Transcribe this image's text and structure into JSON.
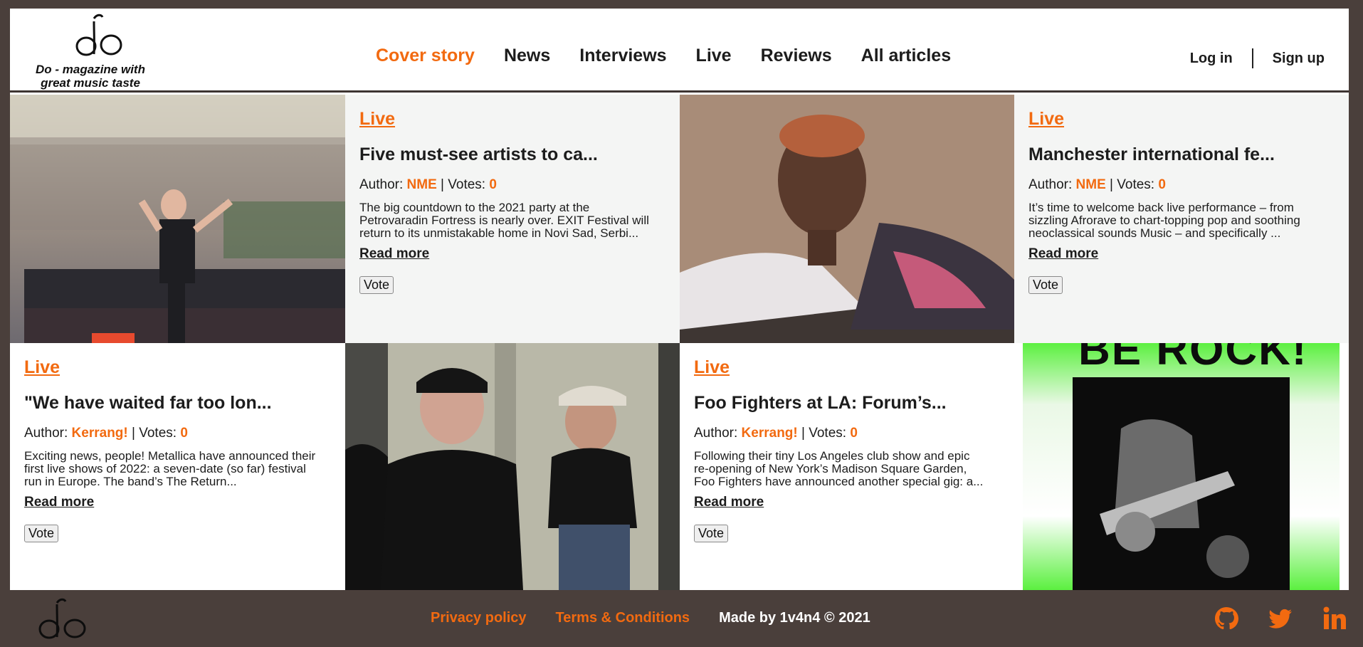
{
  "brand": {
    "tagline": "Do - magazine with great music taste"
  },
  "nav": {
    "items": [
      "Cover story",
      "News",
      "Interviews",
      "Live",
      "Reviews",
      "All articles"
    ],
    "active": "Cover story"
  },
  "auth": {
    "login": "Log in",
    "signup": "Sign up"
  },
  "articles": [
    {
      "category": "Live",
      "title": "Five must-see artists to ca...",
      "author_label": "Author: ",
      "author": "NME",
      "votes_label": " | Votes: ",
      "votes": "0",
      "excerpt": "The big countdown to the 2021 party at the Petrovaradin Fortress is nearly over. EXIT Festival will return to its unmistakable home in Novi Sad, Serbi...",
      "read_more": "Read more",
      "vote": "Vote"
    },
    {
      "category": "Live",
      "title": "Manchester international fe...",
      "author_label": "Author: ",
      "author": "NME",
      "votes_label": " | Votes: ",
      "votes": "0",
      "excerpt": "It’s time to welcome back live performance – from sizzling Afrorave to chart-topping pop and soothing neoclassical sounds Music – and specifically ...",
      "read_more": "Read more",
      "vote": "Vote"
    },
    {
      "category": "Live",
      "title": "\"We have waited far too lon...",
      "author_label": "Author: ",
      "author": "Kerrang!",
      "votes_label": " | Votes: ",
      "votes": "0",
      "excerpt": "Exciting news, people! Metallica have announced their first live shows of 2022: a seven-date (so far) festival run in Europe. The band’s The Return...",
      "read_more": "Read more",
      "vote": "Vote"
    },
    {
      "category": "Live",
      "title": "Foo Fighters at LA: Forum’s...",
      "author_label": "Author: ",
      "author": "Kerrang!",
      "votes_label": " | Votes: ",
      "votes": "0",
      "excerpt": "Following their tiny Los Angeles club show and epic re-opening of New York’s Madison Square Garden, Foo Fighters have announced another special gig: a...",
      "read_more": "Read more",
      "vote": "Vote"
    }
  ],
  "poster_text": "BE ROCK!",
  "footer": {
    "privacy": "Privacy policy",
    "terms": "Terms & Conditions",
    "made_by": "Made by 1v4n4 © 2021"
  },
  "colors": {
    "accent": "#f26a10",
    "footer_bg": "#4a3f3b",
    "card_gray": "#f4f5f4",
    "poster_green": "#5cf040"
  },
  "icons": [
    "logo-icon",
    "github-icon",
    "twitter-icon",
    "linkedin-icon"
  ]
}
